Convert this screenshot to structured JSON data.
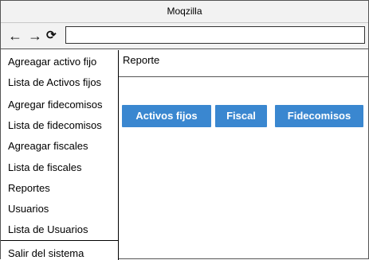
{
  "window": {
    "title": "Moqzilla"
  },
  "nav": {
    "back_icon": "←",
    "forward_icon": "→",
    "reload_icon": "⟳",
    "url": ""
  },
  "sidebar": {
    "items": [
      {
        "label": "Agreagar activo fijo"
      },
      {
        "label": "Lista de Activos fijos"
      },
      {
        "label": "Agregar fidecomisos"
      },
      {
        "label": "Lista de fidecomisos"
      },
      {
        "label": "Agreagar fiscales"
      },
      {
        "label": "Lista de fiscales"
      },
      {
        "label": "Reportes"
      },
      {
        "label": "Usuarios"
      },
      {
        "label": "Lista de Usuarios"
      }
    ],
    "logout": "Salir del sistema"
  },
  "main": {
    "title": "Reporte",
    "buttons": [
      {
        "label": "Activos fijos"
      },
      {
        "label": "Fiscal"
      },
      {
        "label": "Fidecomisos"
      }
    ]
  },
  "colors": {
    "button_bg": "#3a87d0",
    "button_text": "#ffffff"
  }
}
